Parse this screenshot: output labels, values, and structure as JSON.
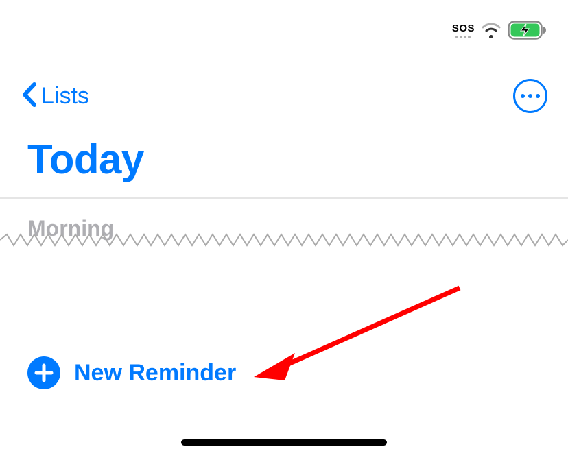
{
  "status_bar": {
    "sos_label": "SOS"
  },
  "nav": {
    "back_label": "Lists"
  },
  "page_title": "Today",
  "section_header": "Morning",
  "new_reminder_label": "New Reminder"
}
